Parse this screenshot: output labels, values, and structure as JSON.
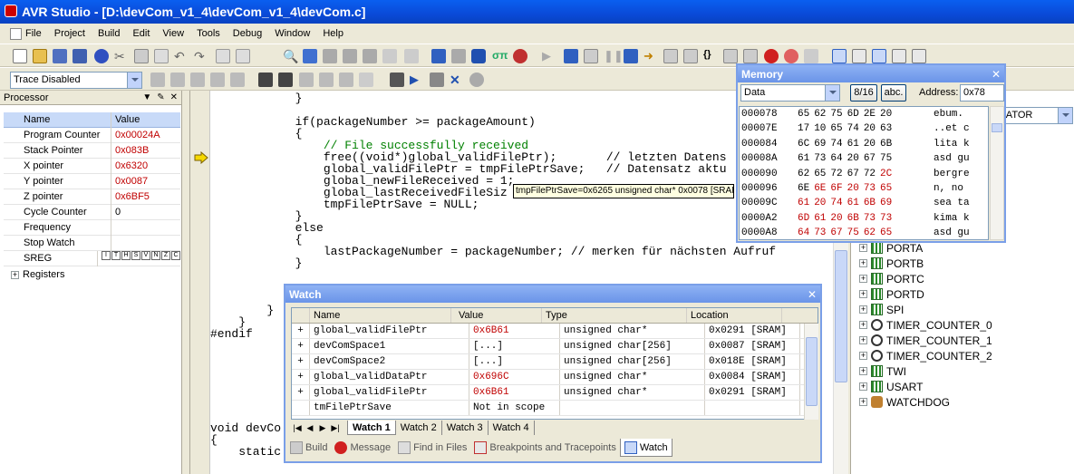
{
  "window": {
    "title": "AVR Studio - [D:\\devCom_v1_4\\devCom_v1_4\\devCom.c]"
  },
  "menu": [
    "File",
    "Project",
    "Build",
    "Edit",
    "View",
    "Tools",
    "Debug",
    "Window",
    "Help"
  ],
  "toolbar2": {
    "trace_mode": "Trace Disabled"
  },
  "processor": {
    "title": "Processor",
    "col_name": "Name",
    "col_value": "Value",
    "rows": [
      {
        "name": "Program Counter",
        "value": "0x00024A"
      },
      {
        "name": "Stack Pointer",
        "value": "0x083B"
      },
      {
        "name": "X pointer",
        "value": "0x6320"
      },
      {
        "name": "Y pointer",
        "value": "0x0087"
      },
      {
        "name": "Z pointer",
        "value": "0x6BF5"
      },
      {
        "name": "Cycle Counter",
        "value": "0"
      },
      {
        "name": "Frequency",
        "value": ""
      },
      {
        "name": "Stop Watch",
        "value": ""
      },
      {
        "name": "SREG",
        "value": ""
      },
      {
        "name": "Registers",
        "value": ""
      }
    ],
    "sreg_bits": [
      "I",
      "T",
      "H",
      "S",
      "V",
      "N",
      "Z",
      "C"
    ]
  },
  "code_lines": [
    {
      "t": "            }"
    },
    {
      "t": ""
    },
    {
      "t": "            if(packageNumber >= packageAmount)"
    },
    {
      "t": "            {"
    },
    {
      "t": "                // File successfully received",
      "cls": "c-com"
    },
    {
      "t": "                free((void*)global_validFilePtr);       // letzten Datens"
    },
    {
      "t": "                global_validFilePtr = tmpFilePtrSave;   // Datensatz aktu"
    },
    {
      "t": "                global_newFileReceived = 1;"
    },
    {
      "t": "                global_lastReceivedFileSiz"
    },
    {
      "t": "                tmpFilePtrSave = NULL;"
    },
    {
      "t": "            }"
    },
    {
      "t": "            else"
    },
    {
      "t": "            {"
    },
    {
      "t": "                lastPackageNumber = packageNumber; // merken für nächsten Aufruf"
    },
    {
      "t": "            }"
    },
    {
      "t": ""
    },
    {
      "t": ""
    },
    {
      "t": ""
    },
    {
      "t": "        }"
    },
    {
      "t": "    }"
    },
    {
      "t": "#endif"
    },
    {
      "t": ""
    },
    {
      "t": ""
    },
    {
      "t": ""
    },
    {
      "t": ""
    },
    {
      "t": ""
    },
    {
      "t": ""
    },
    {
      "t": ""
    },
    {
      "t": "void devCo"
    },
    {
      "t": "{"
    },
    {
      "t": "    static  unsigned short byteCnt = 0; // 0 beim ersten Programmaufruf"
    }
  ],
  "tooltip": "tmpFilePtrSave=0x6265 unsigned char*  0x0078 [SRAM]",
  "memory": {
    "title": "Memory",
    "type": "Data",
    "width_btn": "8/16",
    "abc_btn": "abc.",
    "address_label": "Address:",
    "address": "0x78",
    "rows": [
      {
        "addr": "000078",
        "bytes": [
          "65",
          "62",
          "75",
          "6D",
          "2E",
          "20"
        ],
        "ascii": "ebum."
      },
      {
        "addr": "00007E",
        "bytes": [
          "17",
          "10",
          "65",
          "74",
          "20",
          "63"
        ],
        "ascii": "..et c"
      },
      {
        "addr": "000084",
        "bytes": [
          "6C",
          "69",
          "74",
          "61",
          "20",
          "6B"
        ],
        "ascii": "lita k"
      },
      {
        "addr": "00008A",
        "bytes": [
          "61",
          "73",
          "64",
          "20",
          "67",
          "75"
        ],
        "ascii": "asd gu"
      },
      {
        "addr": "000090",
        "bytes": [
          "62",
          "65",
          "72",
          "67",
          "72",
          "2C"
        ],
        "ascii": "bergre"
      },
      {
        "addr": "000096",
        "bytes": [
          "6E",
          "6E",
          "6F",
          "20",
          "73",
          "65"
        ],
        "ascii": "n, no"
      },
      {
        "addr": "00009C",
        "bytes": [
          "61",
          "20",
          "74",
          "61",
          "6B",
          "69"
        ],
        "ascii": "sea ta"
      },
      {
        "addr": "0000A2",
        "bytes": [
          "6D",
          "61",
          "20",
          "6B",
          "73",
          "73"
        ],
        "ascii": "kima k"
      },
      {
        "addr": "0000A8",
        "bytes": [
          "64",
          "73",
          "67",
          "75",
          "62",
          "65"
        ],
        "ascii": "asd gu"
      }
    ]
  },
  "watch": {
    "title": "Watch",
    "cols": [
      "Name",
      "Value",
      "Type",
      "Location"
    ],
    "rows": [
      {
        "name": "global_validFilePtr",
        "value": "0x6B61",
        "type": "unsigned char*",
        "loc": "0x0291 [SRAM]"
      },
      {
        "name": "devComSpace1",
        "value": "[...]",
        "type": "unsigned char[256]",
        "loc": "0x0087 [SRAM]"
      },
      {
        "name": "devComSpace2",
        "value": "[...]",
        "type": "unsigned char[256]",
        "loc": "0x018E [SRAM]"
      },
      {
        "name": "global_validDataPtr",
        "value": "0x696C",
        "type": "unsigned char*",
        "loc": "0x0084 [SRAM]"
      },
      {
        "name": "global_validFilePtr",
        "value": "0x6B61",
        "type": "unsigned char*",
        "loc": "0x0291 [SRAM]"
      },
      {
        "name": "tmFilePtrSave",
        "value": "Not in scope",
        "type": "",
        "loc": ""
      }
    ],
    "tabs": [
      "Watch 1",
      "Watch 2",
      "Watch 3",
      "Watch 4"
    ]
  },
  "bottom_tabs": [
    "Build",
    "Message",
    "Find in Files",
    "Breakpoints and Tracepoints",
    "Watch"
  ],
  "io_view": {
    "separator_select": "PARATOR",
    "items": [
      "PORTA",
      "PORTB",
      "PORTC",
      "PORTD",
      "SPI",
      "TIMER_COUNTER_0",
      "TIMER_COUNTER_1",
      "TIMER_COUNTER_2",
      "TWI",
      "USART",
      "WATCHDOG"
    ]
  }
}
